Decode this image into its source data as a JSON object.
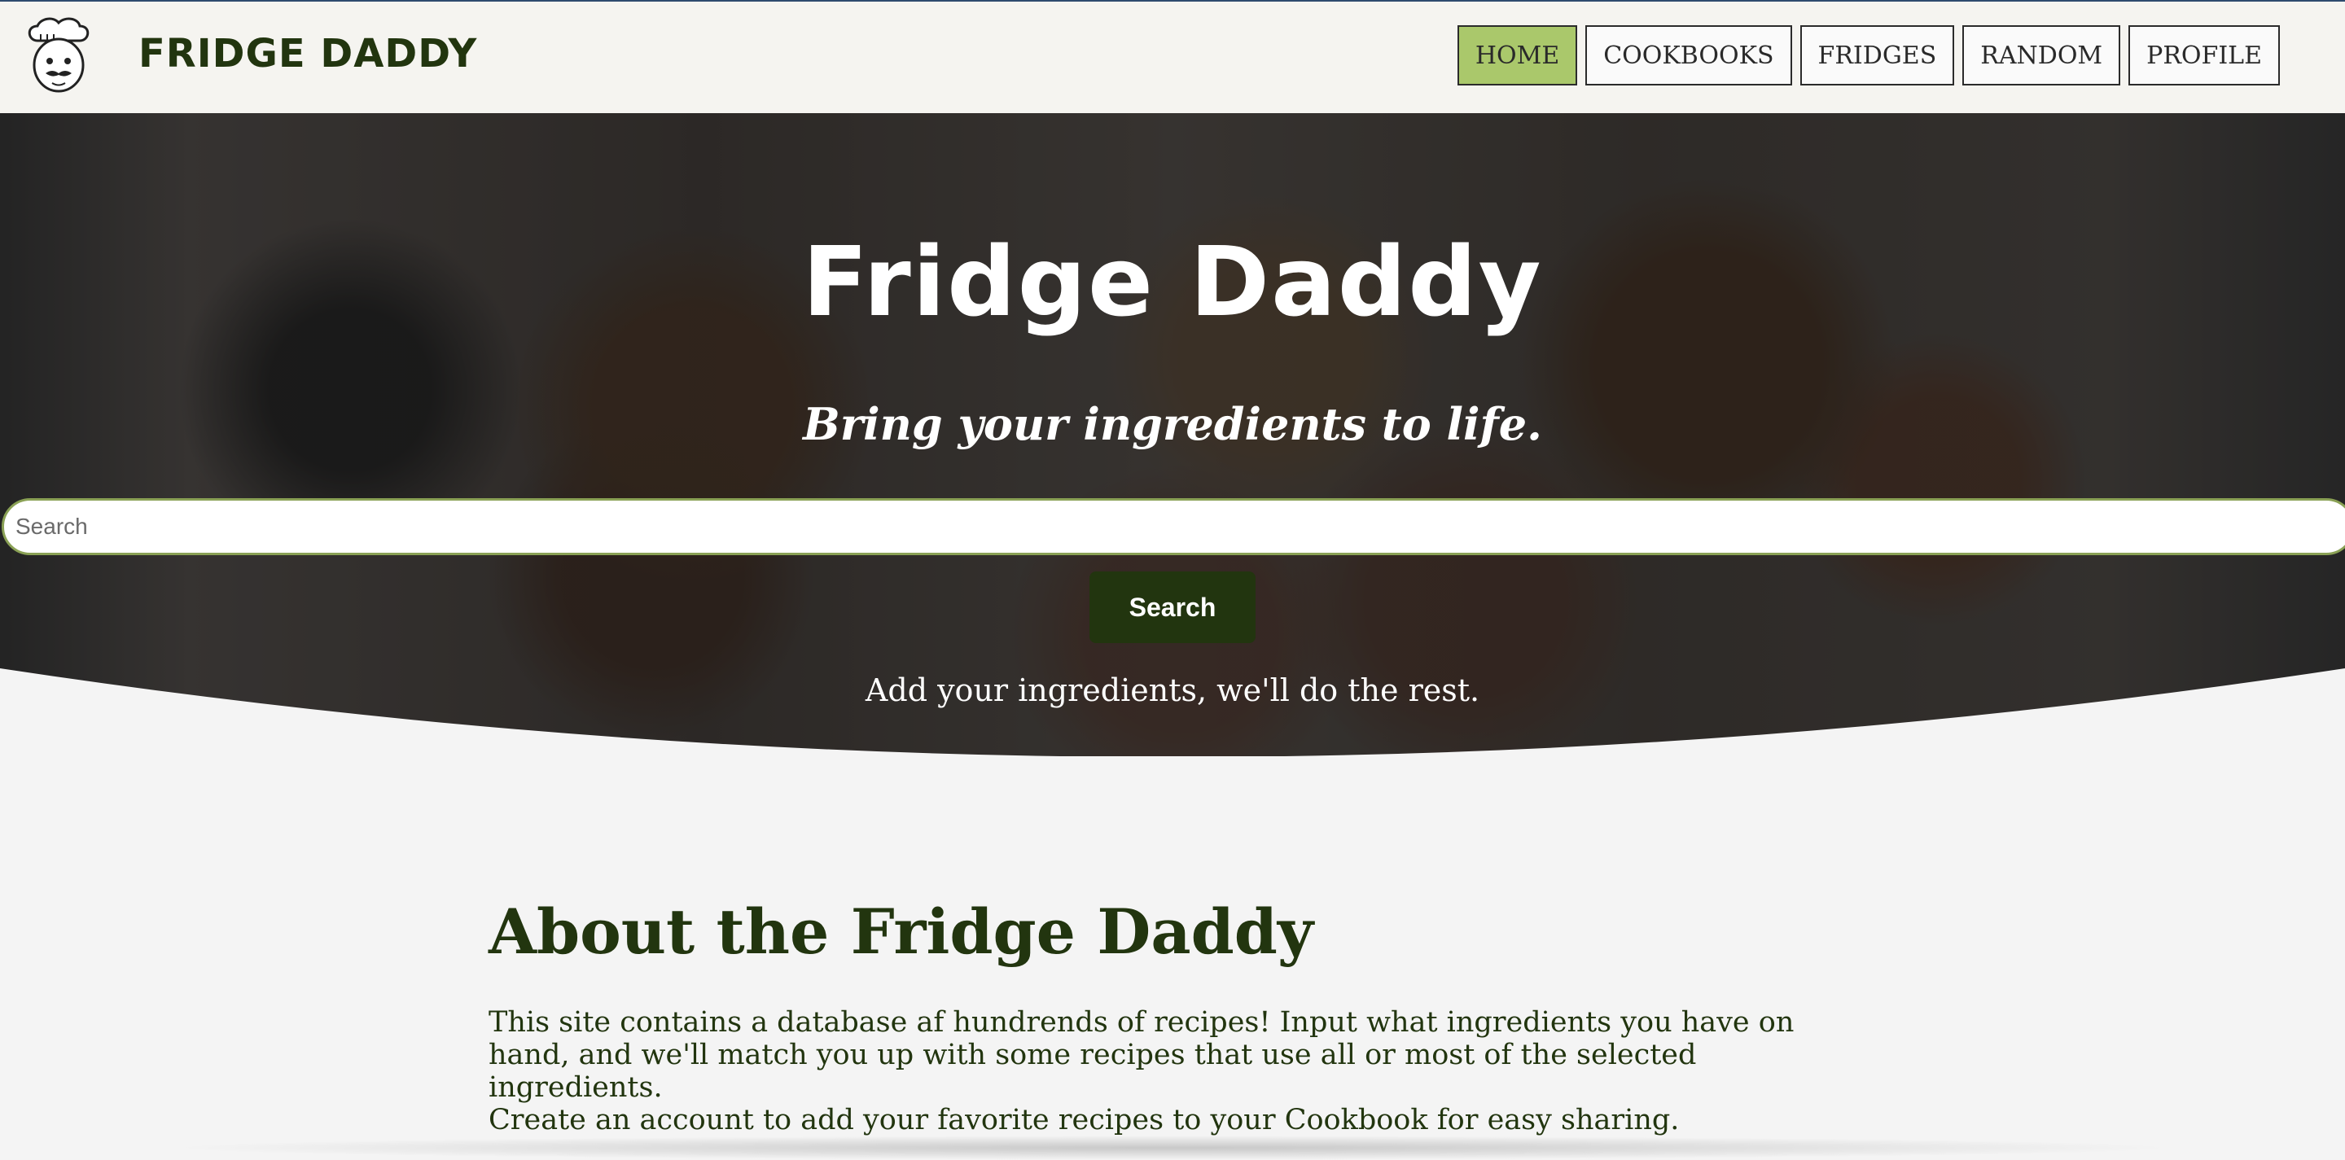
{
  "brand": {
    "name": "FRIDGE DADDY",
    "logo_icon": "chef-face-icon"
  },
  "nav": {
    "items": [
      {
        "label": "HOME",
        "active": true
      },
      {
        "label": "COOKBOOKS",
        "active": false
      },
      {
        "label": "FRIDGES",
        "active": false
      },
      {
        "label": "RANDOM",
        "active": false
      },
      {
        "label": "PROFILE",
        "active": false
      }
    ]
  },
  "hero": {
    "title": "Fridge Daddy",
    "subtitle": "Bring your ingredients to life.",
    "search_placeholder": "Search",
    "search_value": "",
    "search_button": "Search",
    "note": "Add your ingredients, we'll do the rest."
  },
  "about": {
    "title": "About the Fridge Daddy",
    "paragraph1": "This site contains a database af hundrends of recipes! Input what ingredients you have on hand, and we'll match you up with some recipes that use all or most of the selected ingredients.",
    "paragraph2": "Create an account to add your favorite recipes to your Cookbook for easy sharing."
  },
  "colors": {
    "brand_green": "#22350f",
    "active_nav": "#aac86b",
    "search_border": "#8aa155"
  }
}
